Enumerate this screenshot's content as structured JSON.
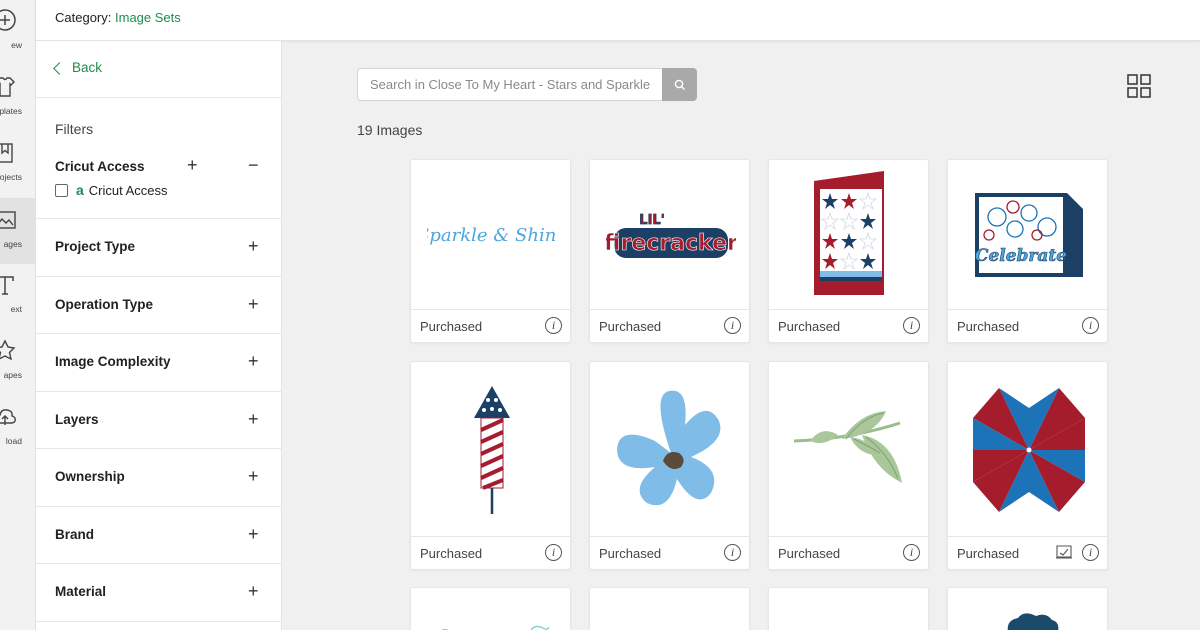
{
  "rail": {
    "items": [
      {
        "label": "ew",
        "icon": "plus-circle-icon"
      },
      {
        "label": "plates",
        "icon": "shirt-icon"
      },
      {
        "label": "ojects",
        "icon": "bookmark-icon"
      },
      {
        "label": "ages",
        "icon": "image-icon",
        "active": true
      },
      {
        "label": "ext",
        "icon": "text-icon"
      },
      {
        "label": "apes",
        "icon": "shapes-icon"
      },
      {
        "label": "load",
        "icon": "upload-cloud-icon"
      }
    ]
  },
  "topbar": {
    "category_prefix": "Category:",
    "category_value": "Image Sets"
  },
  "filters": {
    "back_label": "Back",
    "title": "Filters",
    "cricut_access": {
      "heading": "Cricut Access",
      "logo": "a",
      "checkbox_label": "Cricut Access",
      "checked": false
    },
    "groups": [
      {
        "label": "Project Type"
      },
      {
        "label": "Operation Type"
      },
      {
        "label": "Image Complexity"
      },
      {
        "label": "Layers"
      },
      {
        "label": "Ownership"
      },
      {
        "label": "Brand"
      },
      {
        "label": "Material"
      }
    ]
  },
  "main": {
    "search_placeholder": "Search in Close To My Heart - Stars and Sparkle",
    "count_text": "19 Images",
    "cards": [
      {
        "status": "Purchased",
        "image": "sparkle-and-shine-text",
        "thumb_text": "Sparkle & Shine"
      },
      {
        "status": "Purchased",
        "image": "lil-firecracker-text",
        "thumb_text_top": "LIL'",
        "thumb_text_main": "firecracker"
      },
      {
        "status": "Purchased",
        "image": "stars-card"
      },
      {
        "status": "Purchased",
        "image": "celebrate-fireworks-card",
        "thumb_text": "Celebrate"
      },
      {
        "status": "Purchased",
        "image": "firework-rocket"
      },
      {
        "status": "Purchased",
        "image": "blue-flower"
      },
      {
        "status": "Purchased",
        "image": "green-leaf-branch"
      },
      {
        "status": "Purchased",
        "image": "pinwheel",
        "has_mat_icon": true
      },
      {
        "status": "",
        "image": "partial-script"
      },
      {
        "status": "",
        "image": "blank"
      },
      {
        "status": "",
        "image": "blank"
      },
      {
        "status": "",
        "image": "partial-navy-shape"
      }
    ]
  },
  "colors": {
    "accent_green": "#1e8c4e",
    "navy": "#1c3f66",
    "red": "#a51d2d",
    "blue": "#1d73b8",
    "light_blue": "#7fbde8",
    "leaf_green": "#a9c79a"
  }
}
